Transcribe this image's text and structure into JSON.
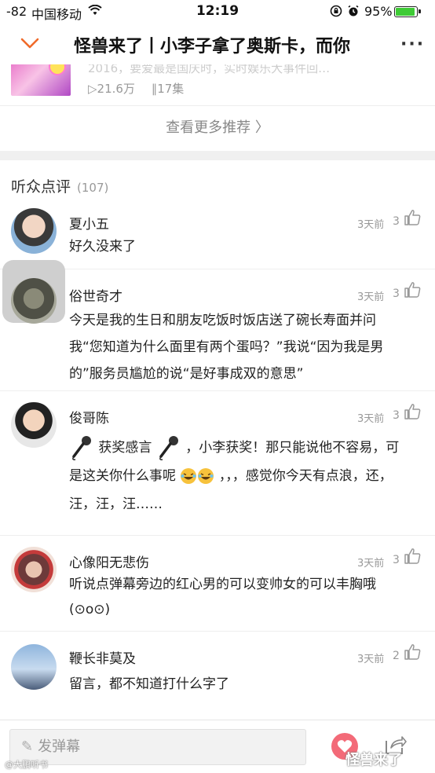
{
  "status_bar": {
    "signal": "-82",
    "carrier": "中国移动",
    "time": "12:19",
    "battery_pct": "95%",
    "battery_level": 0.95
  },
  "nav": {
    "title": "怪兽来了丨小李子拿了奥斯卡，而你",
    "more": "···"
  },
  "recommendation": {
    "desc": "2016，要爱最是国庆时，实时娱乐大事件回…",
    "plays": "▷21.6万",
    "episodes": "∥17集",
    "see_more": "查看更多推荐 〉"
  },
  "comments_section": {
    "title": "听众点评",
    "count": "(107)"
  },
  "comments": [
    {
      "name": "夏小五",
      "time": "3天前",
      "likes": "3",
      "text": "好久没来了"
    },
    {
      "name": "俗世奇才",
      "time": "3天前",
      "likes": "3",
      "lines": [
        "今天是我的生日和朋友吃饭时饭店送了碗长寿面并问",
        "我“您知道为什么面里有两个蛋吗？”我说“因为我是男",
        "的”服务员尴尬的说“是好事成双的意思”"
      ]
    },
    {
      "name": "俊哥陈",
      "time": "3天前",
      "likes": "3",
      "line1_a": "获奖感言",
      "line1_b": "，小李获奖！那只能说他不容易，可",
      "line2_a": "是这关你什么事呢",
      "line2_b": "，，，感觉你今天有点浪，还，",
      "line3": "汪，汪，汪……"
    },
    {
      "name": "心像阳无悲伤",
      "time": "3天前",
      "likes": "3",
      "lines": [
        "听说点弹幕旁边的红心男的可以变帅女的可以丰胸哦",
        "(⊙o⊙)"
      ]
    },
    {
      "name": "鞭长非莫及",
      "time": "3天前",
      "likes": "2",
      "text": "留言，都不知道打什么字了"
    }
  ],
  "bottom_bar": {
    "danmu_placeholder": "发弹幕",
    "watermark": "怪兽来了",
    "watermark_small": "@大鹏听书"
  },
  "colors": {
    "accent_orange": "#f06a2a",
    "battery_green": "#3ecb35",
    "heart_red": "#f36a78"
  }
}
